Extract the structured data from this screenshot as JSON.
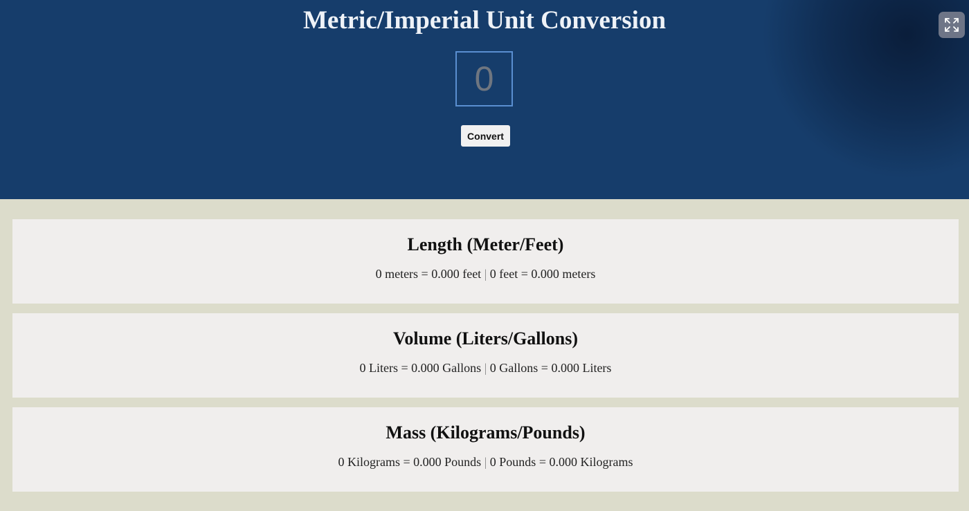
{
  "header": {
    "title": "Metric/Imperial Unit Conversion",
    "input_placeholder": "0",
    "convert_label": "Convert",
    "background_color": "#163d6b"
  },
  "controls": {
    "fullscreen_icon": "expand-icon"
  },
  "cards": [
    {
      "title": "Length (Meter/Feet)",
      "left": "0 meters = 0.000 feet",
      "separator": "|",
      "right": "0 feet = 0.000 meters"
    },
    {
      "title": "Volume (Liters/Gallons)",
      "left": "0 Liters = 0.000 Gallons",
      "separator": "|",
      "right": "0 Gallons = 0.000 Liters"
    },
    {
      "title": "Mass (Kilograms/Pounds)",
      "left": "0 Kilograms = 0.000 Pounds",
      "separator": "|",
      "right": "0 Pounds = 0.000 Kilograms"
    }
  ],
  "colors": {
    "page_background": "#dcdccb",
    "card_background": "#f0eeed",
    "input_border": "#5a8fd1"
  }
}
